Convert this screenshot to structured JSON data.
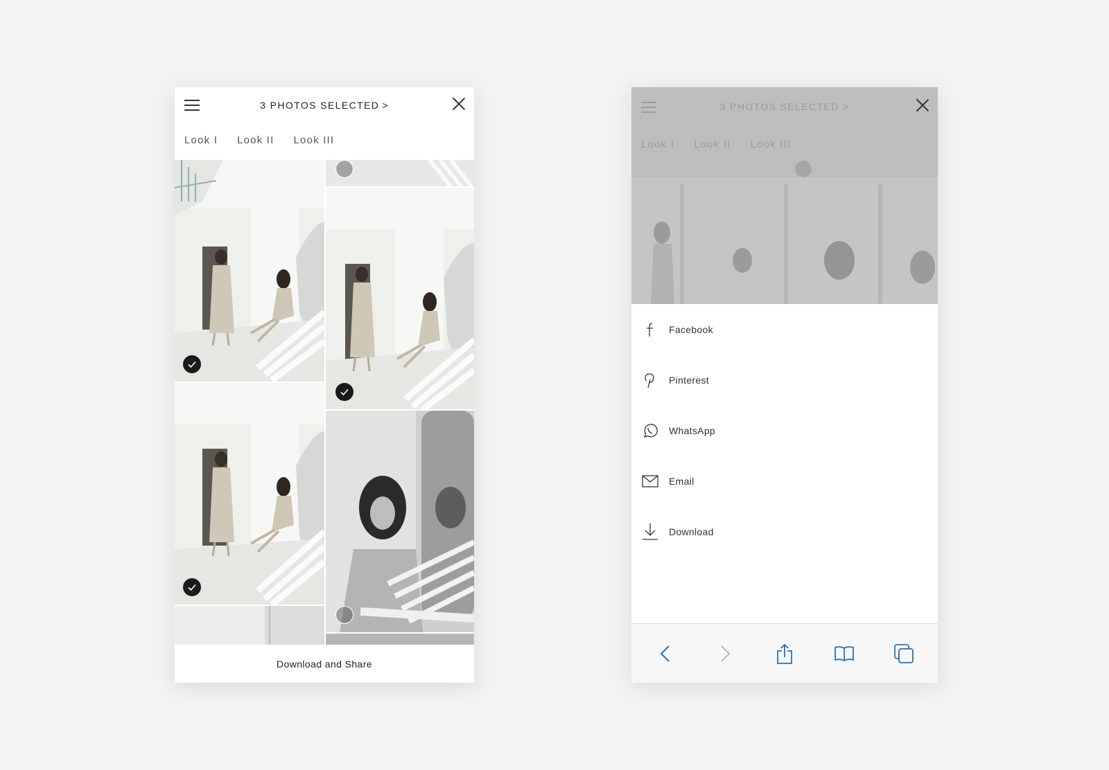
{
  "left_screen": {
    "header": {
      "title": "3 PHOTOS SELECTED",
      "title_chevron": ">"
    },
    "tabs": [
      {
        "label": "Look I"
      },
      {
        "label": "Look II"
      },
      {
        "label": "Look III"
      }
    ],
    "footer_button": "Download and Share"
  },
  "right_screen": {
    "dimmed_header_title": "3 PHOTOS SELECTED",
    "dimmed_title_chevron": ">",
    "dimmed_tabs": [
      {
        "label": "Look I"
      },
      {
        "label": "Look II"
      },
      {
        "label": "Look III"
      }
    ],
    "share_options": [
      {
        "label": "Facebook",
        "icon": "facebook-icon"
      },
      {
        "label": "Pinterest",
        "icon": "pinterest-icon"
      },
      {
        "label": "WhatsApp",
        "icon": "whatsapp-icon"
      },
      {
        "label": "Email",
        "icon": "email-icon"
      },
      {
        "label": "Download",
        "icon": "download-icon"
      }
    ],
    "browser_toolbar": [
      "back-icon",
      "forward-icon",
      "share-icon",
      "bookmarks-icon",
      "tabs-icon"
    ]
  },
  "colors": {
    "background": "#f3f3f3",
    "checked": "#1a1a1a",
    "toolbar_accent": "#2f6fb5",
    "toolbar_disabled": "#b8b8b8",
    "overlay": "#bdbdbd"
  }
}
